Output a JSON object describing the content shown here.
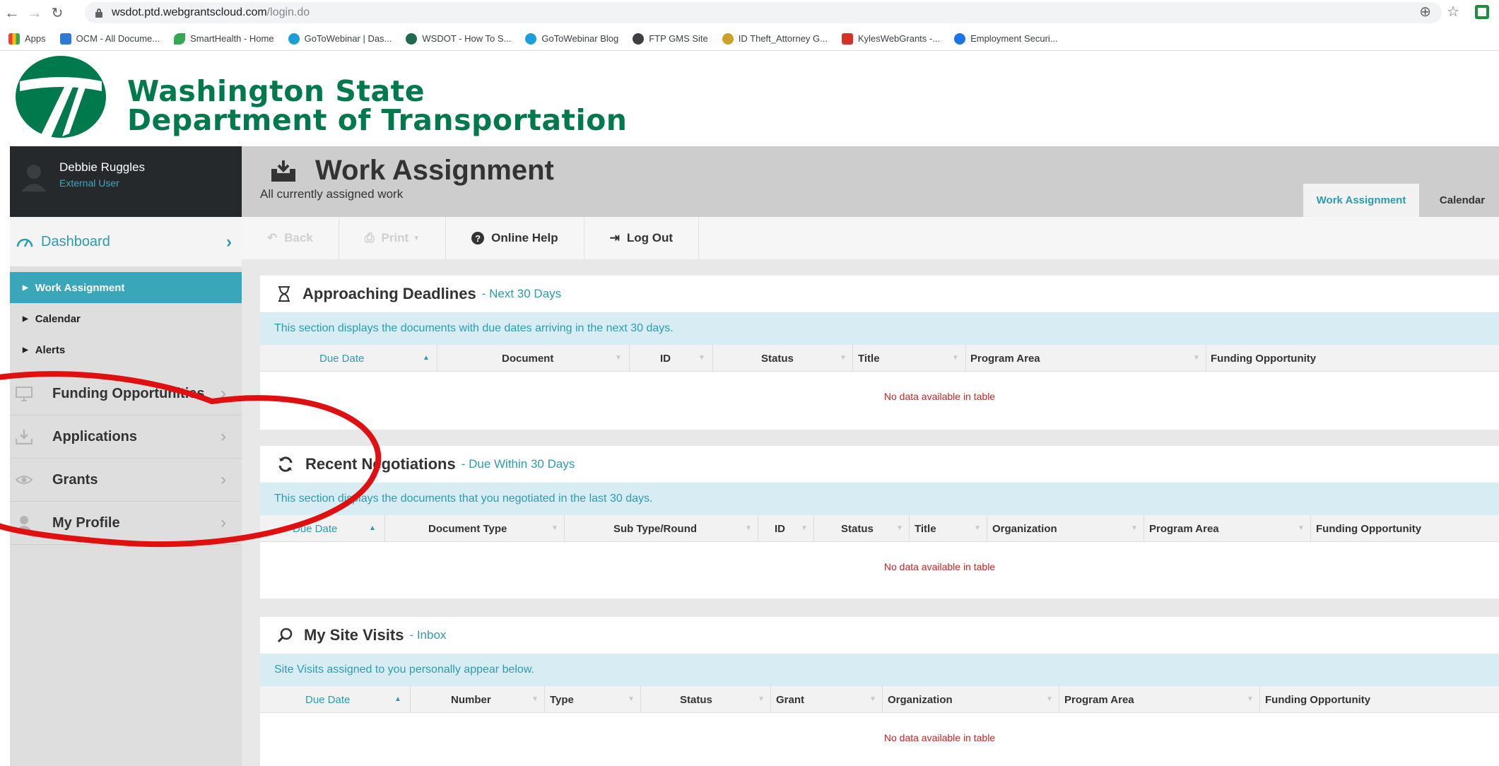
{
  "browser": {
    "url_host": "wsdot.ptd.webgrantscloud.com",
    "url_path": "/login.do",
    "bookmarks": [
      {
        "label": "Apps",
        "color": "#4285f4"
      },
      {
        "label": "OCM - All Docume...",
        "color": "#2c7ad6"
      },
      {
        "label": "SmartHealth - Home",
        "color": "#34a853"
      },
      {
        "label": "GoToWebinar | Das...",
        "color": "#1a9fd9"
      },
      {
        "label": "WSDOT - How To S...",
        "color": "#1e6b52"
      },
      {
        "label": "GoToWebinar Blog",
        "color": "#1a9fd9"
      },
      {
        "label": "FTP GMS Site",
        "color": "#3c4043"
      },
      {
        "label": "ID Theft_Attorney G...",
        "color": "#c9a227"
      },
      {
        "label": "KylesWebGrants -...",
        "color": "#d93025"
      },
      {
        "label": "Employment Securi...",
        "color": "#1a73e8"
      }
    ]
  },
  "header": {
    "agency_line1": "Washington State",
    "agency_line2": "Department of Transportation",
    "brand_color": "#007a4d"
  },
  "user": {
    "name": "Debbie Ruggles",
    "role": "External User"
  },
  "sidebar": {
    "dashboard": "Dashboard",
    "dashboard_arrow": "›",
    "subitems": [
      "Work Assignment",
      "Calendar",
      "Alerts"
    ],
    "items": [
      "Funding Opportunities",
      "Applications",
      "Grants",
      "My Profile"
    ],
    "item_arrow": "›"
  },
  "page": {
    "title": "Work Assignment",
    "subtitle": "All currently assigned work",
    "tabs": [
      "Work Assignment",
      "Calendar"
    ]
  },
  "toolbar": {
    "back": "Back",
    "print": "Print",
    "help": "Online Help",
    "logout": "Log Out"
  },
  "panels": [
    {
      "title": "Approaching Deadlines",
      "tag": "- Next 30 Days",
      "desc": "This section displays the documents with due dates arriving in the next 30 days.",
      "columns": [
        "Due Date",
        "Document",
        "ID",
        "Status",
        "Title",
        "Program Area",
        "Funding Opportunity"
      ],
      "empty": "No data available in table"
    },
    {
      "title": "Recent Negotiations",
      "tag": "- Due Within 30 Days",
      "desc": "This section displays the documents that you negotiated in the last 30 days.",
      "columns": [
        "Due Date",
        "Document Type",
        "Sub Type/Round",
        "ID",
        "Status",
        "Title",
        "Organization",
        "Program Area",
        "Funding Opportunity"
      ],
      "empty": "No data available in table"
    },
    {
      "title": "My Site Visits",
      "tag": "- Inbox",
      "desc": "Site Visits assigned to you personally appear below.",
      "columns": [
        "Due Date",
        "Number",
        "Type",
        "Status",
        "Grant",
        "Organization",
        "Program Area",
        "Funding Opportunity"
      ],
      "empty": "No data available in table"
    }
  ],
  "colors": {
    "accent": "#2b9bb1",
    "annotation": "#e01010"
  }
}
